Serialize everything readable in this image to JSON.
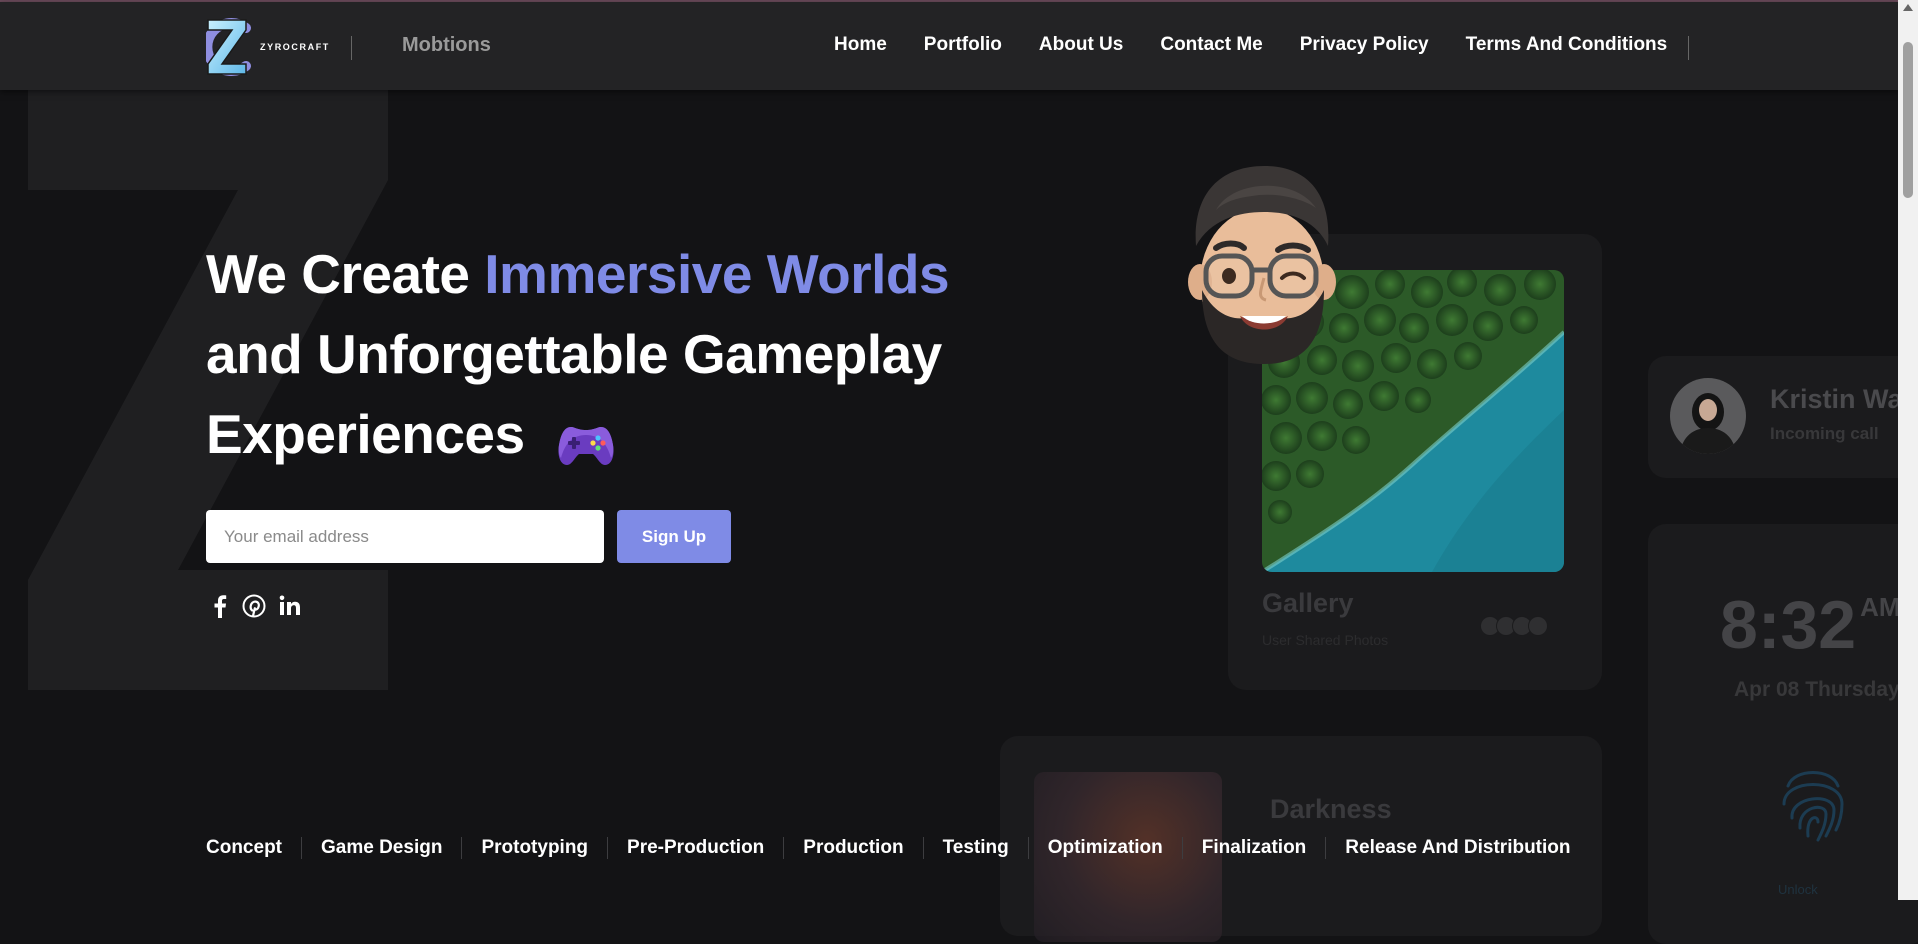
{
  "brand": {
    "logo_text": "ZYROCRAFT",
    "name": "Mobtions"
  },
  "nav": {
    "items": [
      {
        "label": "Home"
      },
      {
        "label": "Portfolio"
      },
      {
        "label": "About Us"
      },
      {
        "label": "Contact Me"
      },
      {
        "label": "Privacy Policy"
      },
      {
        "label": "Terms And Conditions"
      }
    ]
  },
  "hero": {
    "title_part1": "We Create ",
    "title_accent": "Immersive Worlds",
    "title_line2": "and Unforgettable Gameplay",
    "title_line3": "Experiences",
    "icon": "gamepad-icon"
  },
  "signup": {
    "placeholder": "Your email address",
    "button_label": "Sign Up"
  },
  "socials": [
    {
      "name": "facebook-icon"
    },
    {
      "name": "pinterest-icon"
    },
    {
      "name": "linkedin-icon"
    }
  ],
  "mockup": {
    "gallery_title": "Gallery",
    "gallery_subtitle": "User Shared Photos",
    "call_name": "Kristin Wa",
    "call_status": "Incoming call",
    "clock_time": "8:32",
    "clock_ampm": "AM",
    "clock_date": "Apr 08 Thursday",
    "unlock_text": "Unlock",
    "dark_title": "Darkness"
  },
  "process": {
    "items": [
      {
        "label": "Concept"
      },
      {
        "label": "Game Design"
      },
      {
        "label": "Prototyping"
      },
      {
        "label": "Pre-Production"
      },
      {
        "label": "Production"
      },
      {
        "label": "Testing"
      },
      {
        "label": "Optimization"
      },
      {
        "label": "Finalization"
      },
      {
        "label": "Release And Distribution"
      }
    ]
  },
  "colors": {
    "accent": "#7f8be6",
    "background": "#131315",
    "navbar": "#232325"
  }
}
